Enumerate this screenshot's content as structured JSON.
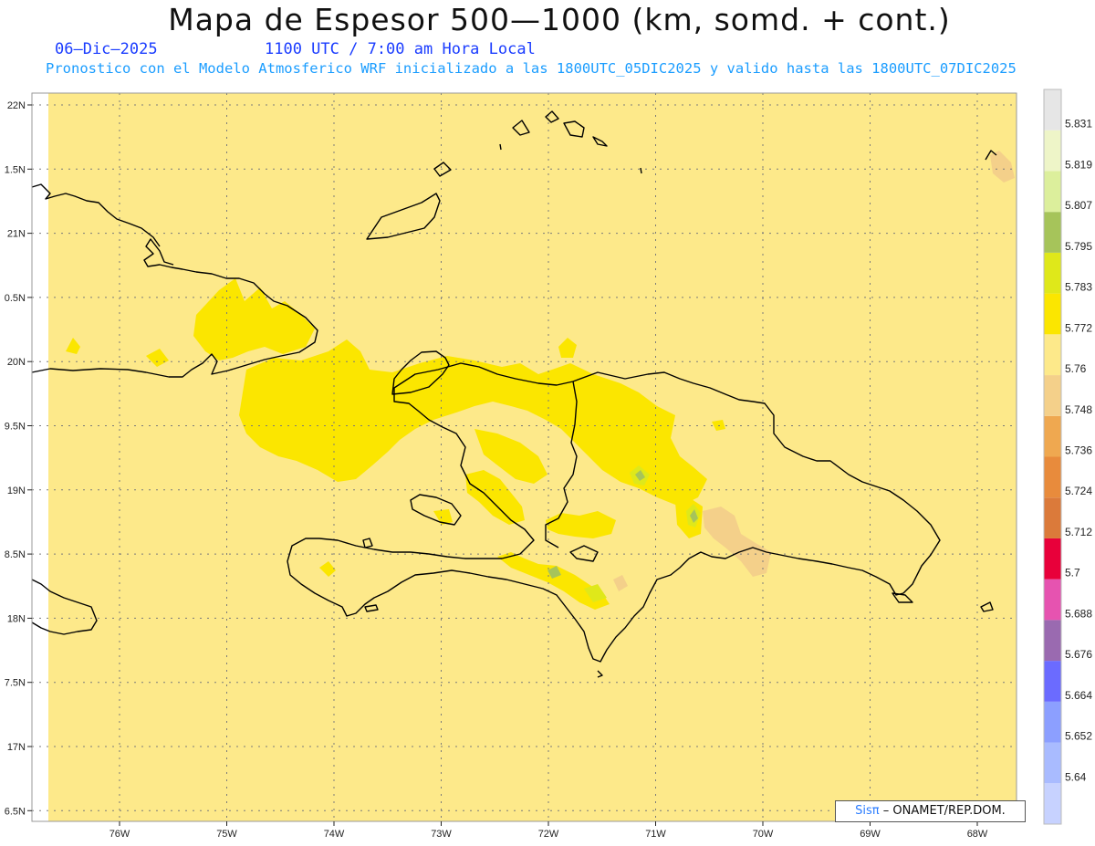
{
  "title": "Mapa de Espesor 500—1000 (km, somd. + cont.)",
  "date": "06–Dic–2025",
  "time": "1100 UTC / 7:00 am Hora Local",
  "forecast": "Pronostico con el Modelo Atmosferico WRF inicializado a las 1800UTC_05DIC2025 y valido hasta las  1800UTC_07DIC2025",
  "credit": {
    "logo": "Sisπ",
    "text": "– ONAMET/REP.DOM."
  },
  "lat_ticks": [
    "22N",
    "1.5N",
    "21N",
    "0.5N",
    "20N",
    "9.5N",
    "19N",
    "8.5N",
    "18N",
    "7.5N",
    "17N",
    "6.5N"
  ],
  "lon_ticks": [
    "76W",
    "75W",
    "74W",
    "73W",
    "72W",
    "71W",
    "70W",
    "69W",
    "68W"
  ],
  "legend": [
    {
      "label": "5.64",
      "color": "#c7d2ff"
    },
    {
      "label": "5.652",
      "color": "#a9bbff"
    },
    {
      "label": "5.664",
      "color": "#8c9fff"
    },
    {
      "label": "5.676",
      "color": "#6b6bff"
    },
    {
      "label": "5.688",
      "color": "#9a6ab0"
    },
    {
      "label": "5.7",
      "color": "#e653b0"
    },
    {
      "label": "5.712",
      "color": "#e8003a"
    },
    {
      "label": "5.724",
      "color": "#db7a3a"
    },
    {
      "label": "5.736",
      "color": "#e88b3c"
    },
    {
      "label": "5.748",
      "color": "#efa850"
    },
    {
      "label": "5.76",
      "color": "#f4d08a"
    },
    {
      "label": "5.772",
      "color": "#fde98a"
    },
    {
      "label": "5.783",
      "color": "#fbe600"
    },
    {
      "label": "5.795",
      "color": "#dfe81a"
    },
    {
      "label": "5.807",
      "color": "#a6c45a"
    },
    {
      "label": "5.819",
      "color": "#dcef9c"
    },
    {
      "label": "5.831",
      "color": "#eef5c8"
    },
    {
      "label": "",
      "color": "#e6e6e6"
    }
  ],
  "colors": {
    "base": "#fde98a",
    "high": "#fbe600",
    "higher": "#dfe81a",
    "peak": "#a6c45a",
    "low": "#f4d08a",
    "coast": "#000000",
    "grid": "#7a7a7a"
  }
}
